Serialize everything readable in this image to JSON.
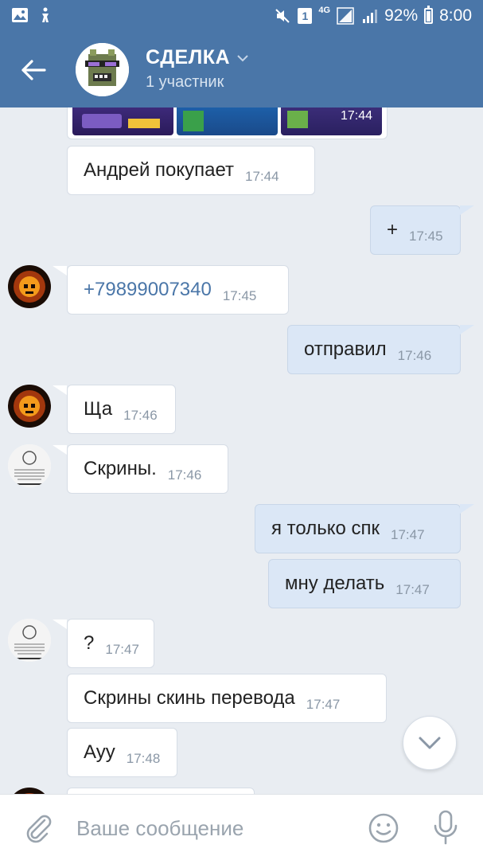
{
  "status_bar": {
    "sim": "1",
    "network": "4G",
    "battery": "92%",
    "time": "8:00"
  },
  "header": {
    "title": "СДЕЛКА",
    "subtitle": "1 участник"
  },
  "media": {
    "time": "17:44"
  },
  "messages": [
    {
      "text": "Андрей покупает",
      "time": "17:44"
    },
    {
      "text": "+",
      "time": "17:45"
    },
    {
      "text": "+79899007340",
      "time": "17:45"
    },
    {
      "text": "отправил",
      "time": "17:46"
    },
    {
      "text": "Ща",
      "time": "17:46"
    },
    {
      "text": "Скрины.",
      "time": "17:46"
    },
    {
      "text": "я только спк",
      "time": "17:47"
    },
    {
      "text": "мну делать",
      "time": "17:47"
    },
    {
      "text": "?",
      "time": "17:47"
    },
    {
      "text": "Скрины скинь перевода",
      "time": "17:47"
    },
    {
      "text": "Ауу",
      "time": "17:48"
    }
  ],
  "composer": {
    "placeholder": "Ваше сообщение"
  },
  "icons": {
    "back": "arrow-left-icon",
    "dropdown": "chevron-down-icon",
    "scroll": "chevron-down-icon",
    "attach": "paperclip-icon",
    "emoji": "smiley-icon",
    "mic": "microphone-icon"
  },
  "colors": {
    "header": "#4a76a8",
    "background": "#e9edf2",
    "outgoing_bubble": "#dbe7f6",
    "incoming_bubble": "#ffffff",
    "link": "#4a76a8"
  }
}
